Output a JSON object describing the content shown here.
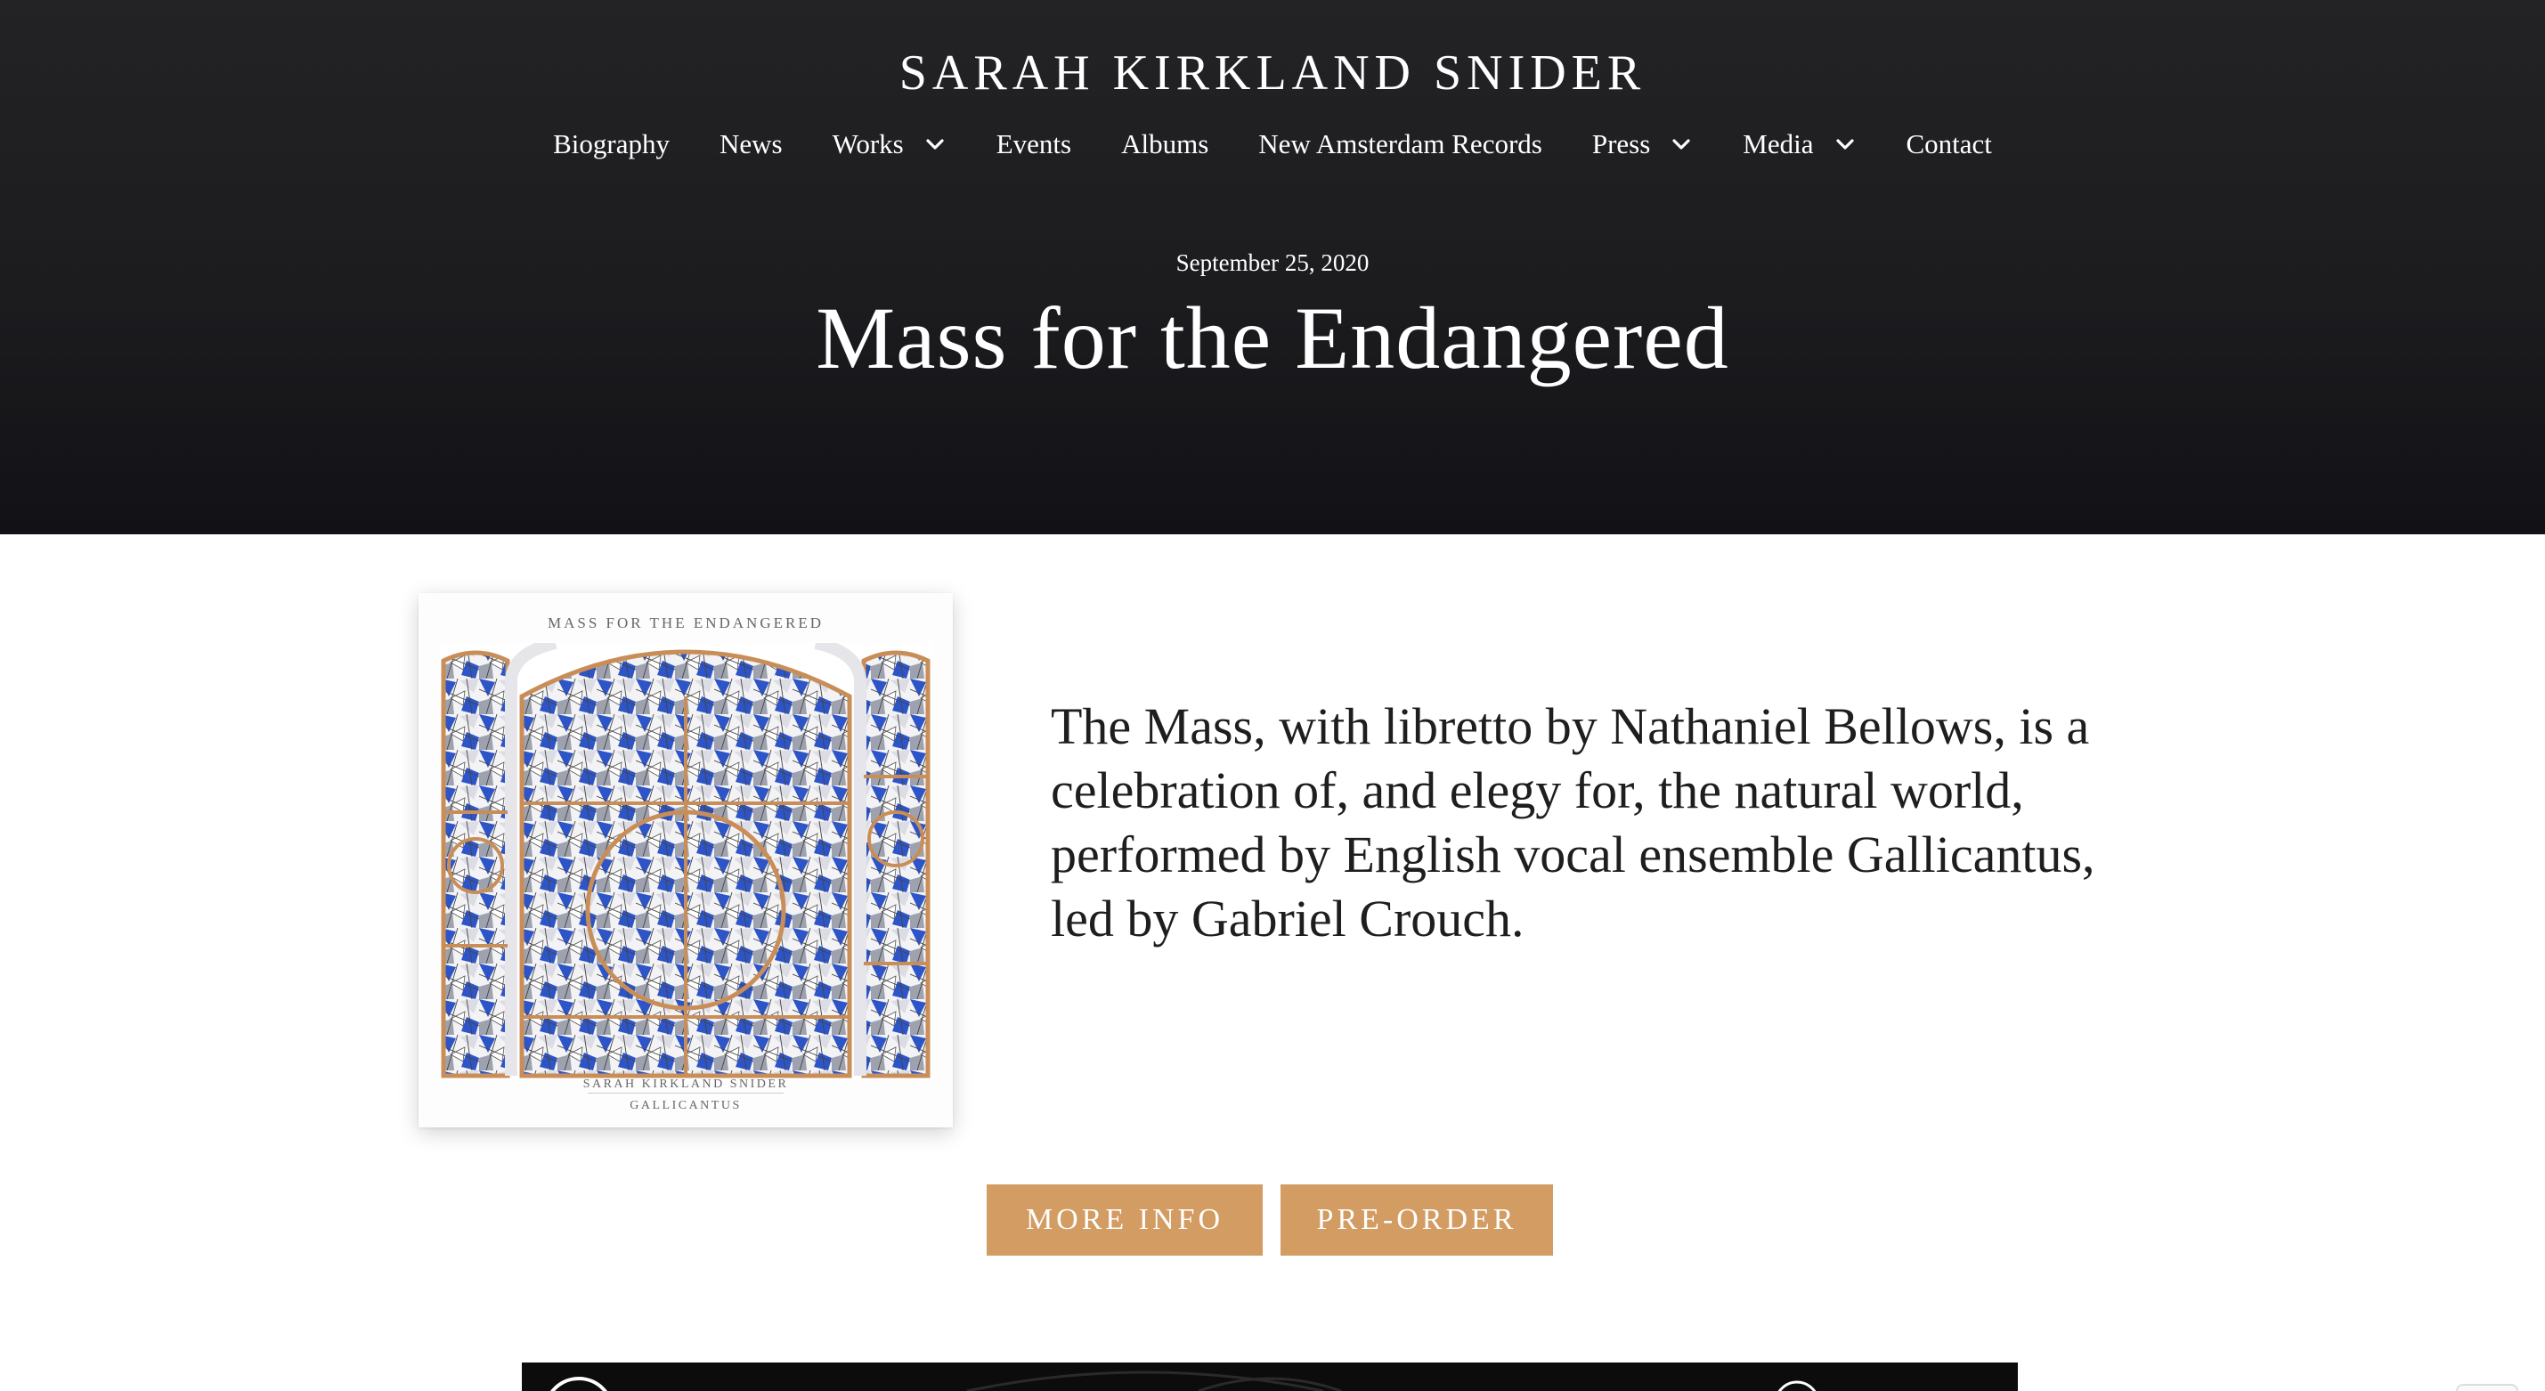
{
  "site": {
    "title": "SARAH KIRKLAND SNIDER"
  },
  "nav": {
    "items": [
      {
        "label": "Biography",
        "has_dropdown": false
      },
      {
        "label": "News",
        "has_dropdown": false
      },
      {
        "label": "Works",
        "has_dropdown": true
      },
      {
        "label": "Events",
        "has_dropdown": false
      },
      {
        "label": "Albums",
        "has_dropdown": false
      },
      {
        "label": "New Amsterdam Records",
        "has_dropdown": false
      },
      {
        "label": "Press",
        "has_dropdown": true
      },
      {
        "label": "Media",
        "has_dropdown": true
      },
      {
        "label": "Contact",
        "has_dropdown": false
      }
    ],
    "dropdown_icon": "chevron-down-icon"
  },
  "post": {
    "date": "September 25, 2020",
    "title": "Mass for the Endangered",
    "intro": "The Mass, with libretto by Nathaniel Bellows, is a celebration of, and elegy for, the natural world, performed by English vocal ensemble Gallicantus, led by Gabriel Crouch."
  },
  "album_cover": {
    "title": "MASS FOR THE ENDANGERED",
    "artist": "SARAH KIRKLAND SNIDER",
    "ensemble": "GALLICANTUS"
  },
  "buttons": {
    "more_info": "MORE INFO",
    "pre_order": "PRE-ORDER"
  },
  "colors": {
    "header_bg": "#1c1c1f",
    "accent": "#d29c63",
    "stained_glass_blue": "#2d55c8",
    "stained_glass_frame": "#c98e58"
  }
}
